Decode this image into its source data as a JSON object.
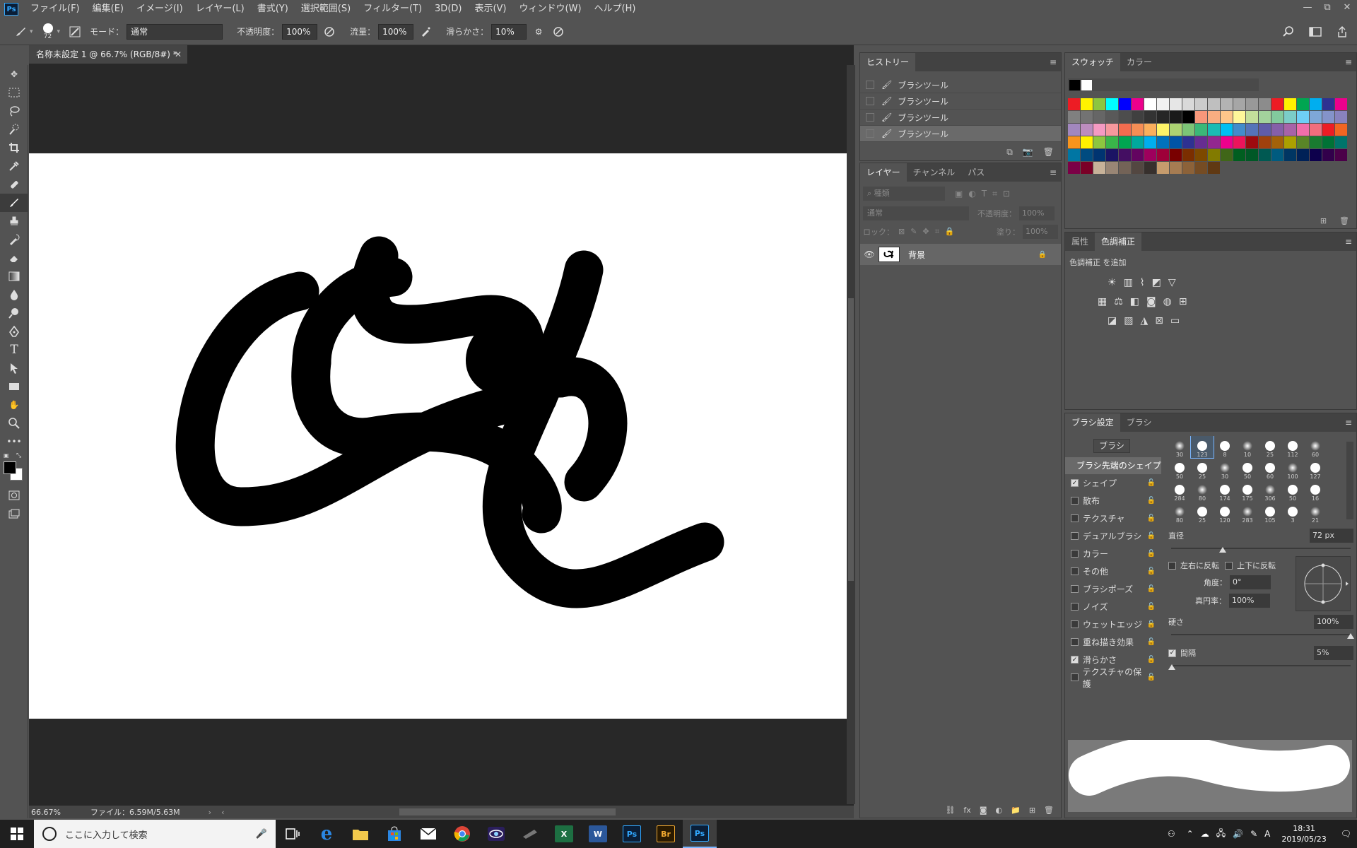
{
  "menubar": {
    "logo": "Ps",
    "items": [
      "ファイル(F)",
      "編集(E)",
      "イメージ(I)",
      "レイヤー(L)",
      "書式(Y)",
      "選択範囲(S)",
      "フィルター(T)",
      "3D(D)",
      "表示(V)",
      "ウィンドウ(W)",
      "ヘルプ(H)"
    ],
    "window_controls": [
      "—",
      "⧉",
      "✕"
    ]
  },
  "options": {
    "brush_size": "72",
    "mode_label": "モード：",
    "mode_value": "通常",
    "opacity_label": "不透明度：",
    "opacity_value": "100%",
    "flow_label": "流量：",
    "flow_value": "100%",
    "smoothing_label": "滑らかさ：",
    "smoothing_value": "10%"
  },
  "document": {
    "tab_title": "名称未設定 1 @ 66.7% (RGB/8#) *",
    "zoom": "66.67%",
    "file_info": "ファイル：6.59M/5.63M"
  },
  "history": {
    "tab": "ヒストリー",
    "items": [
      "ブラシツール",
      "ブラシツール",
      "ブラシツール",
      "ブラシツール"
    ]
  },
  "layers": {
    "tabs": [
      "レイヤー",
      "チャンネル",
      "パス"
    ],
    "search_placeholder": "種類",
    "blend_mode": "通常",
    "opacity_label": "不透明度：",
    "opacity_value": "100%",
    "lock_label": "ロック：",
    "fill_label": "塗り：",
    "fill_value": "100%",
    "layer_name": "背景"
  },
  "swatches": {
    "tabs": [
      "スウォッチ",
      "カラー"
    ],
    "colors": [
      "#ed1c24",
      "#fff200",
      "#8dc63f",
      "#00ffff",
      "#0000ff",
      "#ec008c",
      "#ffffff",
      "#f2f2f2",
      "#e6e6e6",
      "#d9d9d9",
      "#cccccc",
      "#bfbfbf",
      "#b3b3b3",
      "#a6a6a6",
      "#999999",
      "#8c8c8c",
      "#ed1c24",
      "#fff200",
      "#00a651",
      "#00aeef",
      "#2e3192",
      "#ec008c",
      "#808080",
      "#737373",
      "#666666",
      "#595959",
      "#4d4d4d",
      "#404040",
      "#333333",
      "#262626",
      "#1a1a1a",
      "#000000",
      "#f7977a",
      "#f9ad81",
      "#fdc68a",
      "#fff79a",
      "#c4df9b",
      "#a3d39c",
      "#82ca9d",
      "#7bcdc8",
      "#6ecff6",
      "#7ea7d8",
      "#8493ca",
      "#8882be",
      "#a187be",
      "#bc8dbf",
      "#f49ac2",
      "#f6989d",
      "#f26c4f",
      "#f68e55",
      "#fbaf5c",
      "#fff467",
      "#acd372",
      "#7cc576",
      "#3bb878",
      "#1abbb4",
      "#00bff3",
      "#438ccb",
      "#5574b9",
      "#605ca8",
      "#855fa8",
      "#a763a8",
      "#f06eaa",
      "#f26d7d",
      "#ed1c24",
      "#f26522",
      "#f7941d",
      "#fff200",
      "#8dc63f",
      "#39b54a",
      "#00a651",
      "#00a99d",
      "#00aeef",
      "#0072bc",
      "#0054a6",
      "#2e3192",
      "#662d91",
      "#92278f",
      "#ec008c",
      "#ed145b",
      "#9e0b0f",
      "#a0410d",
      "#a36209",
      "#aba000",
      "#598527",
      "#197b30",
      "#007236",
      "#00746b",
      "#0076a3",
      "#004b80",
      "#003471",
      "#1b1464",
      "#440e62",
      "#630460",
      "#9e005d",
      "#9e0039",
      "#790000",
      "#7b2e00",
      "#7d4900",
      "#827b00",
      "#406618",
      "#005e20",
      "#005826",
      "#005952",
      "#005b7f",
      "#003663",
      "#002157",
      "#0d004c",
      "#32004b",
      "#4b0049",
      "#7b0046",
      "#7a0026",
      "#c7b299",
      "#998675",
      "#736357",
      "#534741",
      "#37302d",
      "#c69c6d",
      "#a67c52",
      "#8c6239",
      "#754c24",
      "#603913"
    ]
  },
  "adjustments": {
    "tabs": [
      "属性",
      "色調補正"
    ],
    "add_label": "色調補正 を追加"
  },
  "brush_settings": {
    "tabs": [
      "ブラシ設定",
      "ブラシ"
    ],
    "brush_button": "ブラシ",
    "tip_shape": "ブラシ先端のシェイプ",
    "options": [
      {
        "label": "シェイプ",
        "checked": true
      },
      {
        "label": "散布",
        "checked": false
      },
      {
        "label": "テクスチャ",
        "checked": false
      },
      {
        "label": "デュアルブラシ",
        "checked": false
      },
      {
        "label": "カラー",
        "checked": false
      },
      {
        "label": "その他",
        "checked": false
      },
      {
        "label": "ブラシポーズ",
        "checked": false
      },
      {
        "label": "ノイズ",
        "checked": false
      },
      {
        "label": "ウェットエッジ",
        "checked": false
      },
      {
        "label": "重ね描き効果",
        "checked": false
      },
      {
        "label": "滑らかさ",
        "checked": true
      },
      {
        "label": "テクスチャの保護",
        "checked": false
      }
    ],
    "presets": [
      "30",
      "123",
      "8",
      "10",
      "25",
      "112",
      "60",
      "50",
      "25",
      "30",
      "50",
      "60",
      "100",
      "127",
      "284",
      "80",
      "174",
      "175",
      "306",
      "50",
      "16",
      "80",
      "25",
      "120",
      "283",
      "105",
      "3",
      "21"
    ],
    "diameter_label": "直径",
    "diameter_value": "72 px",
    "flip_x": "左右に反転",
    "flip_y": "上下に反転",
    "angle_label": "角度：",
    "angle_value": "0°",
    "roundness_label": "真円率：",
    "roundness_value": "100%",
    "hardness_label": "硬さ",
    "hardness_value": "100%",
    "spacing_label": "間隔",
    "spacing_value": "5%"
  },
  "taskbar": {
    "search_placeholder": "ここに入力して検索",
    "apps": [
      "Ps",
      "Br",
      "Ps"
    ],
    "time": "18:31",
    "date": "2019/05/23",
    "ime": "A"
  }
}
